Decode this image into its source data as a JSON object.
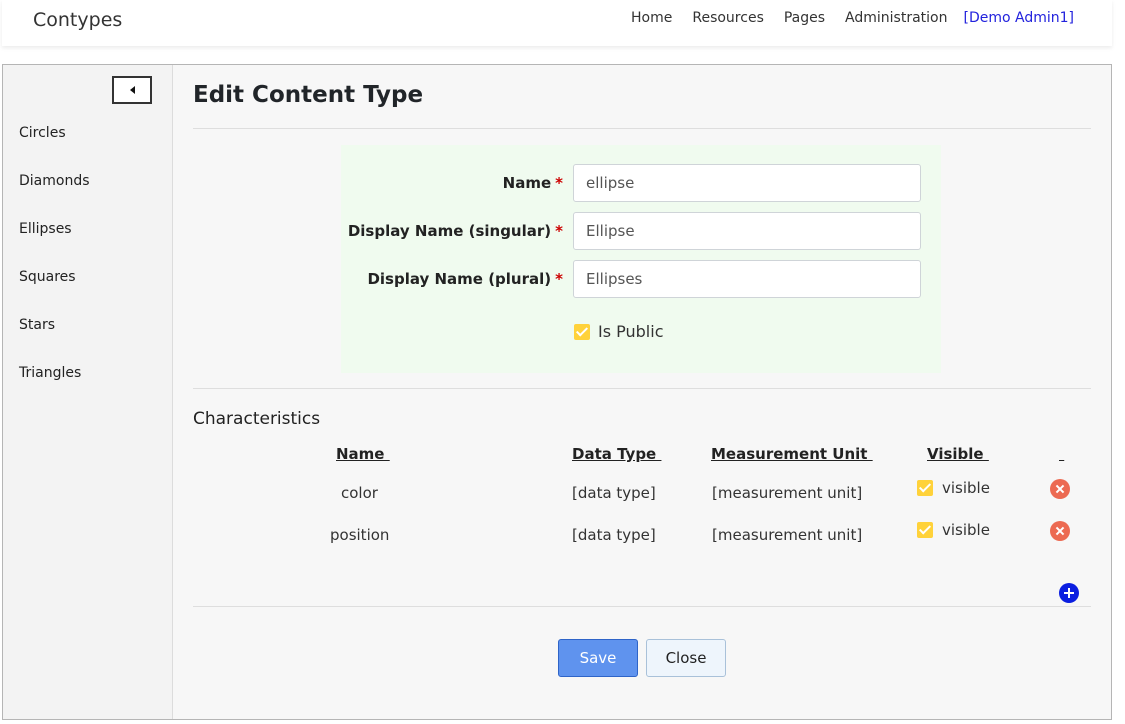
{
  "app": {
    "brand": "Contypes"
  },
  "nav": {
    "links": [
      "Home",
      "Resources",
      "Pages",
      "Administration"
    ],
    "user": "[Demo Admin1]"
  },
  "sidebar": {
    "items": [
      "Circles",
      "Diamonds",
      "Ellipses",
      "Squares",
      "Stars",
      "Triangles"
    ]
  },
  "page": {
    "title": "Edit Content Type"
  },
  "form": {
    "name_label": "Name",
    "name_value": "ellipse",
    "singular_label": "Display Name (singular)",
    "singular_value": "Ellipse",
    "plural_label": "Display Name (plural)",
    "plural_value": "Ellipses",
    "required_marker": "*",
    "is_public_label": "Is Public",
    "is_public": true
  },
  "characteristics": {
    "title": "Characteristics",
    "headers": {
      "name": "Name ",
      "data_type": "Data Type ",
      "unit": "Measurement Unit ",
      "visible": "Visible ",
      "actions": " "
    },
    "rows": [
      {
        "name": "color",
        "data_type": "[data type]",
        "unit": "[measurement unit]",
        "visible_label": "visible",
        "visible": true
      },
      {
        "name": "position",
        "data_type": "[data type]",
        "unit": "[measurement unit]",
        "visible_label": "visible",
        "visible": true
      }
    ]
  },
  "buttons": {
    "save": "Save",
    "close": "Close"
  },
  "colors": {
    "accent": "#5f93ee",
    "checkbox": "#ffd23a",
    "delete": "#ec6a52",
    "add": "#0b1ee0",
    "form_bg": "#f0fbef"
  },
  "icons": {
    "collapse": "caret-left-icon",
    "delete": "remove-circle-icon",
    "add": "add-circle-icon",
    "check": "checkbox-checked-icon"
  }
}
